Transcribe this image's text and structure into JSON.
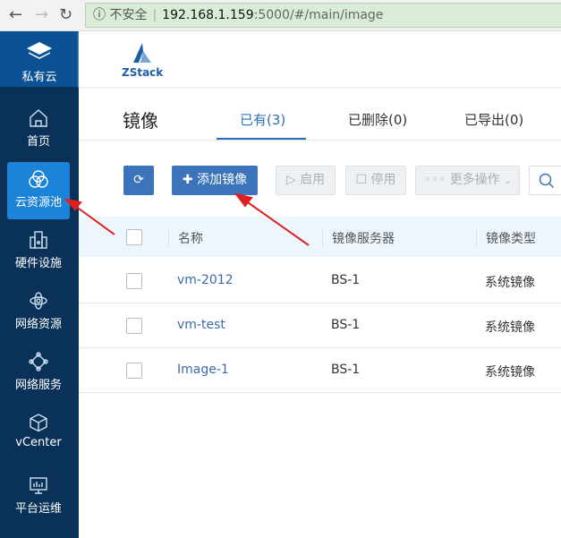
{
  "browser": {
    "insecure_label": "不安全",
    "url_host": "192.168.1.159",
    "url_path": ":5000/#/main/image"
  },
  "sidebar": {
    "brand": "私有云",
    "items": [
      {
        "label": "首页",
        "icon": "home-icon"
      },
      {
        "label": "云资源池",
        "icon": "resource-pool-icon",
        "active": true
      },
      {
        "label": "硬件设施",
        "icon": "building-icon"
      },
      {
        "label": "网络资源",
        "icon": "network-icon"
      },
      {
        "label": "网络服务",
        "icon": "network-service-icon"
      },
      {
        "label": "vCenter",
        "icon": "cube-icon"
      },
      {
        "label": "平台运维",
        "icon": "monitor-icon"
      }
    ]
  },
  "header": {
    "logo_text": "ZStack"
  },
  "page": {
    "title": "镜像",
    "tabs": [
      {
        "label": "已有(3)",
        "active": true
      },
      {
        "label": "已删除(0)"
      },
      {
        "label": "已导出(0)"
      }
    ]
  },
  "toolbar": {
    "add": "添加镜像",
    "enable": "启用",
    "disable": "停用",
    "more": "更多操作"
  },
  "table": {
    "columns": [
      "名称",
      "镜像服务器",
      "镜像类型"
    ],
    "rows": [
      {
        "name": "vm-2012",
        "server": "BS-1",
        "type": "系统镜像"
      },
      {
        "name": "vm-test",
        "server": "BS-1",
        "type": "系统镜像"
      },
      {
        "name": "Image-1",
        "server": "BS-1",
        "type": "系统镜像"
      }
    ]
  },
  "colors": {
    "sidebar": "#0a3158",
    "brand": "#0b5294",
    "active": "#1b84d9",
    "primary": "#3b74bb",
    "annotation": "#e02020"
  }
}
